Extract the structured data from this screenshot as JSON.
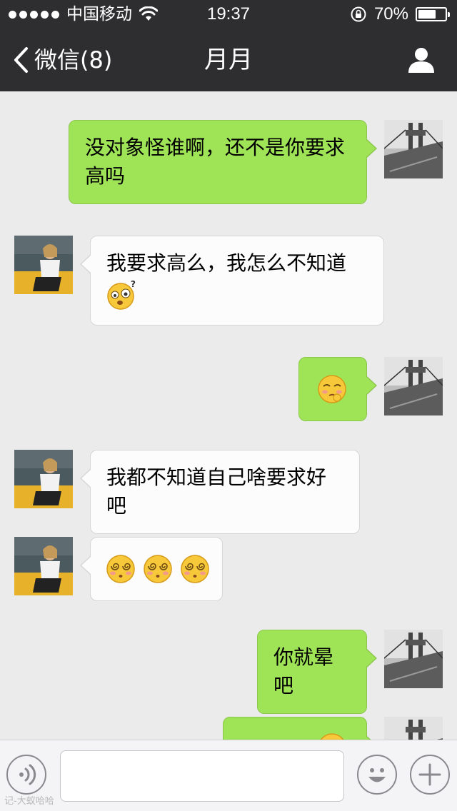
{
  "status_bar": {
    "carrier": "中国移动",
    "time": "19:37",
    "battery_percent": "70%",
    "battery_level": 0.7,
    "signal_dots": 5
  },
  "nav": {
    "back_label": "微信(8)",
    "title": "月月"
  },
  "messages": [
    {
      "direction": "out",
      "text": "没对象怪谁啊，还不是你要求高吗"
    },
    {
      "direction": "in",
      "text": "我要求高么，我怎么不知道",
      "emoji": [
        "confused-face"
      ]
    },
    {
      "direction": "out",
      "emoji": [
        "smirk-face"
      ]
    },
    {
      "direction": "in",
      "text": "我都不知道自己啥要求好吧"
    },
    {
      "direction": "in",
      "emoji": [
        "dizzy-face",
        "dizzy-face",
        "dizzy-face"
      ]
    },
    {
      "direction": "out",
      "text": "你就晕吧"
    },
    {
      "direction": "out",
      "emoji": [
        "partial-emoji"
      ]
    }
  ],
  "input": {
    "placeholder": "",
    "value": ""
  },
  "watermark": "记-大蚁哈哈",
  "colors": {
    "header": "#2e2e30",
    "chat_bg": "#ebebeb",
    "bubble_out": "#9fe457",
    "bubble_in": "#fcfcfc"
  }
}
